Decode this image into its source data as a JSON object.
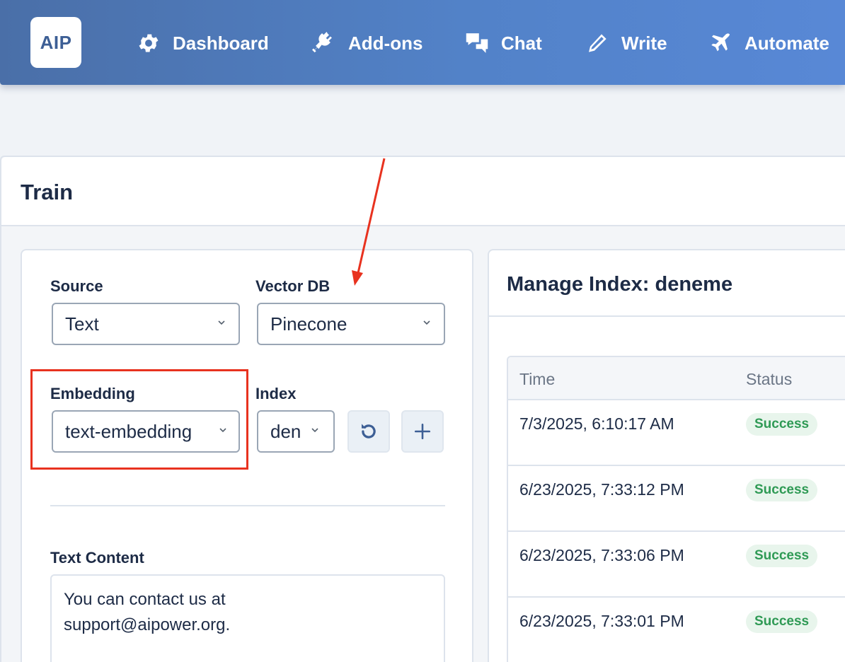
{
  "header": {
    "logo_text": "AIP",
    "nav": [
      {
        "label": "Dashboard",
        "icon": "gear-icon"
      },
      {
        "label": "Add-ons",
        "icon": "plug-icon"
      },
      {
        "label": "Chat",
        "icon": "chat-bubbles-icon"
      },
      {
        "label": "Write",
        "icon": "pencil-icon"
      },
      {
        "label": "Automate",
        "icon": "plane-icon"
      }
    ]
  },
  "train": {
    "title": "Train",
    "form": {
      "source_label": "Source",
      "source_value": "Text",
      "vectordb_label": "Vector DB",
      "vectordb_value": "Pinecone",
      "embedding_label": "Embedding",
      "embedding_value": "text-embedding",
      "index_label": "Index",
      "index_value": "den",
      "refresh_icon": "refresh-icon",
      "add_icon": "plus-icon",
      "text_content_label": "Text Content",
      "text_content_value": "You can contact us at\nsupport@aipower.org."
    },
    "manage": {
      "title": "Manage Index: deneme",
      "columns": [
        "Time",
        "Status"
      ],
      "rows": [
        {
          "time": "7/3/2025, 6:10:17 AM",
          "status": "Success"
        },
        {
          "time": "6/23/2025, 7:33:12 PM",
          "status": "Success"
        },
        {
          "time": "6/23/2025, 7:33:06 PM",
          "status": "Success"
        },
        {
          "time": "6/23/2025, 7:33:01 PM",
          "status": "Success"
        }
      ]
    }
  },
  "annotations": {
    "highlight_color": "#e8321f"
  },
  "colors": {
    "header_gradient_start": "#4a6fa8",
    "header_gradient_end": "#5888d6",
    "success_text": "#2f9a55",
    "success_bg": "#e8f5ec",
    "text_dark": "#1d2b46"
  }
}
